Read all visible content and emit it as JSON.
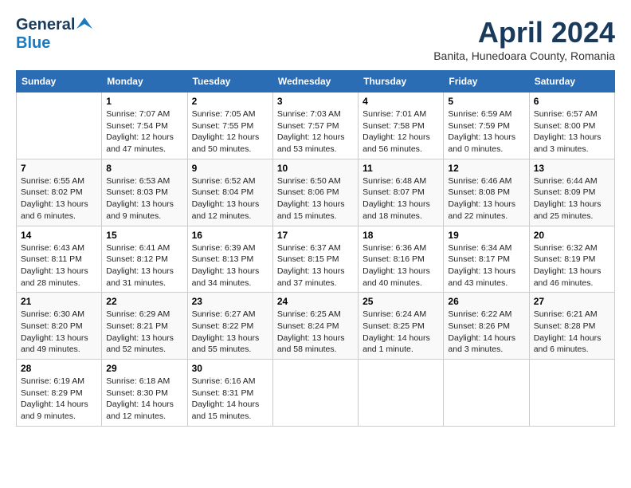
{
  "header": {
    "logo_general": "General",
    "logo_blue": "Blue",
    "month_title": "April 2024",
    "subtitle": "Banita, Hunedoara County, Romania"
  },
  "days_of_week": [
    "Sunday",
    "Monday",
    "Tuesday",
    "Wednesday",
    "Thursday",
    "Friday",
    "Saturday"
  ],
  "weeks": [
    [
      {
        "day": "",
        "info": ""
      },
      {
        "day": "1",
        "info": "Sunrise: 7:07 AM\nSunset: 7:54 PM\nDaylight: 12 hours\nand 47 minutes."
      },
      {
        "day": "2",
        "info": "Sunrise: 7:05 AM\nSunset: 7:55 PM\nDaylight: 12 hours\nand 50 minutes."
      },
      {
        "day": "3",
        "info": "Sunrise: 7:03 AM\nSunset: 7:57 PM\nDaylight: 12 hours\nand 53 minutes."
      },
      {
        "day": "4",
        "info": "Sunrise: 7:01 AM\nSunset: 7:58 PM\nDaylight: 12 hours\nand 56 minutes."
      },
      {
        "day": "5",
        "info": "Sunrise: 6:59 AM\nSunset: 7:59 PM\nDaylight: 13 hours\nand 0 minutes."
      },
      {
        "day": "6",
        "info": "Sunrise: 6:57 AM\nSunset: 8:00 PM\nDaylight: 13 hours\nand 3 minutes."
      }
    ],
    [
      {
        "day": "7",
        "info": "Sunrise: 6:55 AM\nSunset: 8:02 PM\nDaylight: 13 hours\nand 6 minutes."
      },
      {
        "day": "8",
        "info": "Sunrise: 6:53 AM\nSunset: 8:03 PM\nDaylight: 13 hours\nand 9 minutes."
      },
      {
        "day": "9",
        "info": "Sunrise: 6:52 AM\nSunset: 8:04 PM\nDaylight: 13 hours\nand 12 minutes."
      },
      {
        "day": "10",
        "info": "Sunrise: 6:50 AM\nSunset: 8:06 PM\nDaylight: 13 hours\nand 15 minutes."
      },
      {
        "day": "11",
        "info": "Sunrise: 6:48 AM\nSunset: 8:07 PM\nDaylight: 13 hours\nand 18 minutes."
      },
      {
        "day": "12",
        "info": "Sunrise: 6:46 AM\nSunset: 8:08 PM\nDaylight: 13 hours\nand 22 minutes."
      },
      {
        "day": "13",
        "info": "Sunrise: 6:44 AM\nSunset: 8:09 PM\nDaylight: 13 hours\nand 25 minutes."
      }
    ],
    [
      {
        "day": "14",
        "info": "Sunrise: 6:43 AM\nSunset: 8:11 PM\nDaylight: 13 hours\nand 28 minutes."
      },
      {
        "day": "15",
        "info": "Sunrise: 6:41 AM\nSunset: 8:12 PM\nDaylight: 13 hours\nand 31 minutes."
      },
      {
        "day": "16",
        "info": "Sunrise: 6:39 AM\nSunset: 8:13 PM\nDaylight: 13 hours\nand 34 minutes."
      },
      {
        "day": "17",
        "info": "Sunrise: 6:37 AM\nSunset: 8:15 PM\nDaylight: 13 hours\nand 37 minutes."
      },
      {
        "day": "18",
        "info": "Sunrise: 6:36 AM\nSunset: 8:16 PM\nDaylight: 13 hours\nand 40 minutes."
      },
      {
        "day": "19",
        "info": "Sunrise: 6:34 AM\nSunset: 8:17 PM\nDaylight: 13 hours\nand 43 minutes."
      },
      {
        "day": "20",
        "info": "Sunrise: 6:32 AM\nSunset: 8:19 PM\nDaylight: 13 hours\nand 46 minutes."
      }
    ],
    [
      {
        "day": "21",
        "info": "Sunrise: 6:30 AM\nSunset: 8:20 PM\nDaylight: 13 hours\nand 49 minutes."
      },
      {
        "day": "22",
        "info": "Sunrise: 6:29 AM\nSunset: 8:21 PM\nDaylight: 13 hours\nand 52 minutes."
      },
      {
        "day": "23",
        "info": "Sunrise: 6:27 AM\nSunset: 8:22 PM\nDaylight: 13 hours\nand 55 minutes."
      },
      {
        "day": "24",
        "info": "Sunrise: 6:25 AM\nSunset: 8:24 PM\nDaylight: 13 hours\nand 58 minutes."
      },
      {
        "day": "25",
        "info": "Sunrise: 6:24 AM\nSunset: 8:25 PM\nDaylight: 14 hours\nand 1 minute."
      },
      {
        "day": "26",
        "info": "Sunrise: 6:22 AM\nSunset: 8:26 PM\nDaylight: 14 hours\nand 3 minutes."
      },
      {
        "day": "27",
        "info": "Sunrise: 6:21 AM\nSunset: 8:28 PM\nDaylight: 14 hours\nand 6 minutes."
      }
    ],
    [
      {
        "day": "28",
        "info": "Sunrise: 6:19 AM\nSunset: 8:29 PM\nDaylight: 14 hours\nand 9 minutes."
      },
      {
        "day": "29",
        "info": "Sunrise: 6:18 AM\nSunset: 8:30 PM\nDaylight: 14 hours\nand 12 minutes."
      },
      {
        "day": "30",
        "info": "Sunrise: 6:16 AM\nSunset: 8:31 PM\nDaylight: 14 hours\nand 15 minutes."
      },
      {
        "day": "",
        "info": ""
      },
      {
        "day": "",
        "info": ""
      },
      {
        "day": "",
        "info": ""
      },
      {
        "day": "",
        "info": ""
      }
    ]
  ]
}
